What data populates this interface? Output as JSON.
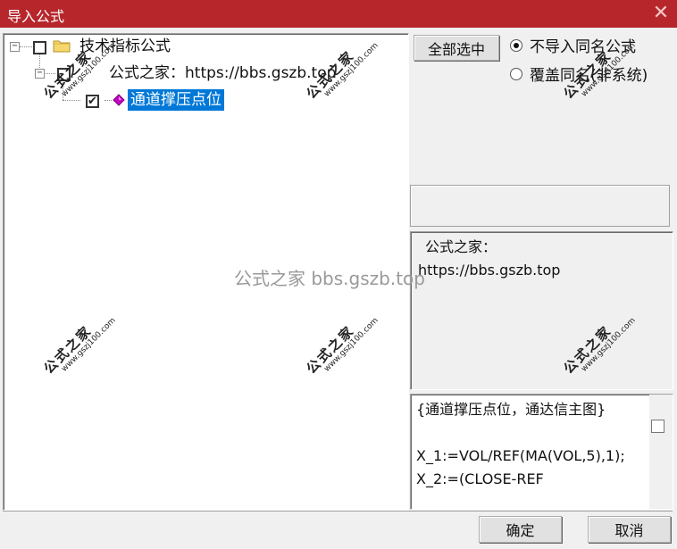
{
  "window": {
    "title": "导入公式",
    "close_glyph": "✕"
  },
  "tree": {
    "root": {
      "label": "技术指标公式",
      "expander": "−",
      "checked": false,
      "icon": "folder-icon"
    },
    "child": {
      "label": "公式之家：https://bbs.gszb.top",
      "expander": "−",
      "checked": false
    },
    "leaf": {
      "label": "通道撑压点位",
      "checked": true,
      "check_glyph": "✔",
      "icon": "gem-icon",
      "icon_color": "#c800c8"
    }
  },
  "options": {
    "select_all_label": "全部选中",
    "radio_no_import": "不导入同名公式",
    "radio_overwrite": "覆盖同名(非系统)",
    "selected": "radio_no_import"
  },
  "info": {
    "line1": "公式之家：",
    "line2": "https://bbs.gszb.top"
  },
  "code": {
    "line1": "{通道撑压点位，通达信主图}",
    "line2": "",
    "line3": "X_1:=VOL/REF(MA(VOL,5),1);",
    "line4": "X_2:=(CLOSE-REF"
  },
  "buttons": {
    "ok": "确定",
    "cancel": "取消"
  },
  "watermark": {
    "center": "公式之家 bbs.gszb.top",
    "main": "公式之家",
    "sub": "www.gszj100.com"
  },
  "colors": {
    "titlebar": "#b6262b",
    "selection": "#0078d7"
  }
}
